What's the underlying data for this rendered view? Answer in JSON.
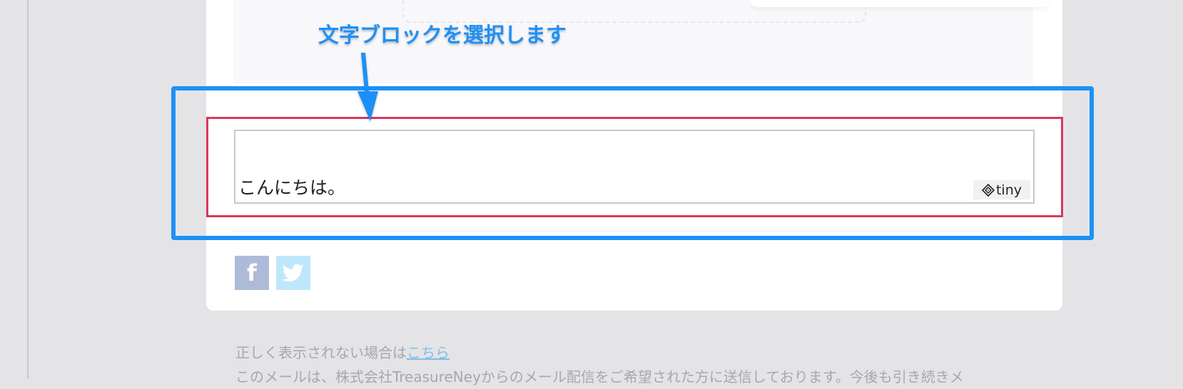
{
  "annotation": {
    "text": "文字ブロックを選択します",
    "color": "#1e90f7"
  },
  "editor": {
    "text": "こんにちは。",
    "tiny_label": "tiny"
  },
  "social": {
    "facebook_icon": "f",
    "twitter_icon": "twitter-bird"
  },
  "footer": {
    "line1_prefix": "正しく表示されない場合は",
    "line1_link": "こちら",
    "line2": "このメールは、株式会社TreasureNeyからのメール配信をご希望された方に送信しております。今後も引き続きメ"
  },
  "colors": {
    "selection_box": "#1e90f7",
    "highlight": "#d6395f",
    "facebook": "#aebbd8",
    "twitter": "#bfe7fb",
    "background": "#e4e4e7"
  }
}
